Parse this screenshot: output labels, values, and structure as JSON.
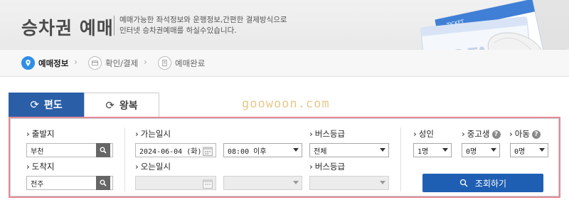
{
  "header": {
    "title": "승차권 예매",
    "desc_line1": "예매가능한 좌석정보와 운행정보,간편한 결제방식으로",
    "desc_line2": "인터넷 승차권예매를 하실수있습니다.",
    "ticket_small": "TICKET",
    "ticket_text": "BUS TAGO"
  },
  "steps": [
    {
      "label": "예매정보",
      "icon": "location-pin-icon"
    },
    {
      "label": "확인/결제",
      "icon": "card-icon"
    },
    {
      "label": "예매완료",
      "icon": "document-icon"
    }
  ],
  "tabs": {
    "oneway": "편도",
    "round": "왕복"
  },
  "watermark": "goowoon.com",
  "form": {
    "departure_label": "출발지",
    "departure_value": "부천",
    "arrival_label": "도착지",
    "arrival_value": "전주",
    "depart_date_label": "가는일시",
    "depart_date_value": "2024-06-04 (화)",
    "depart_time_value": "08:00 이후",
    "return_date_label": "오는일시",
    "bus_grade_label": "버스등급",
    "bus_grade_value": "전체",
    "bus_grade_label2": "버스등급",
    "adult_label": "성인",
    "adult_value": "1명",
    "youth_label": "중고생",
    "youth_value": "0명",
    "child_label": "아동",
    "child_value": "0명",
    "help_glyph": "?",
    "search_button": "조회하기"
  },
  "colors": {
    "primary": "#2a5fa8",
    "button": "#1f5fb3",
    "panel_border": "#e48a93",
    "step_active": "#2f8ee6"
  }
}
